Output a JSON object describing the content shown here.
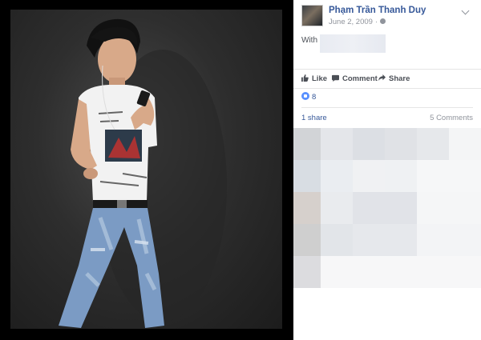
{
  "post": {
    "author": "Phạm Trần Thanh Duy",
    "date": "June 2, 2009",
    "separator": "·",
    "with_label": "With"
  },
  "actions": {
    "like": "Like",
    "comment": "Comment",
    "share": "Share"
  },
  "reactions": {
    "count": "8"
  },
  "stats": {
    "shares": "1 share",
    "comments": "5 Comments"
  },
  "colors": {
    "link": "#365899",
    "muted": "#90949c",
    "like_badge": "#5890ff"
  },
  "icons": {
    "avatar": "profile-photo",
    "privacy": "globe-icon",
    "menu": "chevron-down-icon",
    "like": "thumbs-up-icon",
    "comment": "speech-bubble-icon",
    "share": "share-arrow-icon"
  }
}
